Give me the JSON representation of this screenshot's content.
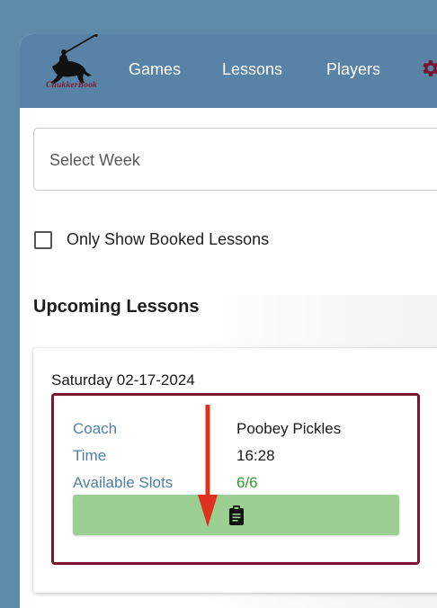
{
  "brand": {
    "logo_text": "ChukkerBook"
  },
  "nav": {
    "items": [
      {
        "label": "Games"
      },
      {
        "label": "Lessons"
      },
      {
        "label": "Players"
      }
    ],
    "settings_icon": "gear-icon"
  },
  "filters": {
    "week_placeholder": "Select Week",
    "only_booked_label": "Only Show Booked Lessons",
    "only_booked_checked": false
  },
  "section": {
    "title": "Upcoming Lessons"
  },
  "lesson": {
    "date": "Saturday 02-17-2024",
    "coach_label": "Coach",
    "coach_value": "Poobey Pickles",
    "time_label": "Time",
    "time_value": "16:28",
    "slots_label": "Available Slots",
    "slots_value": "6/6",
    "book_icon": "clipboard-icon"
  },
  "colors": {
    "navbar": "#5883a6",
    "accent_border": "#7b1530",
    "book_button": "#9cd092",
    "slots_green": "#2f9c2a",
    "annotation_arrow": "#e0301e"
  }
}
